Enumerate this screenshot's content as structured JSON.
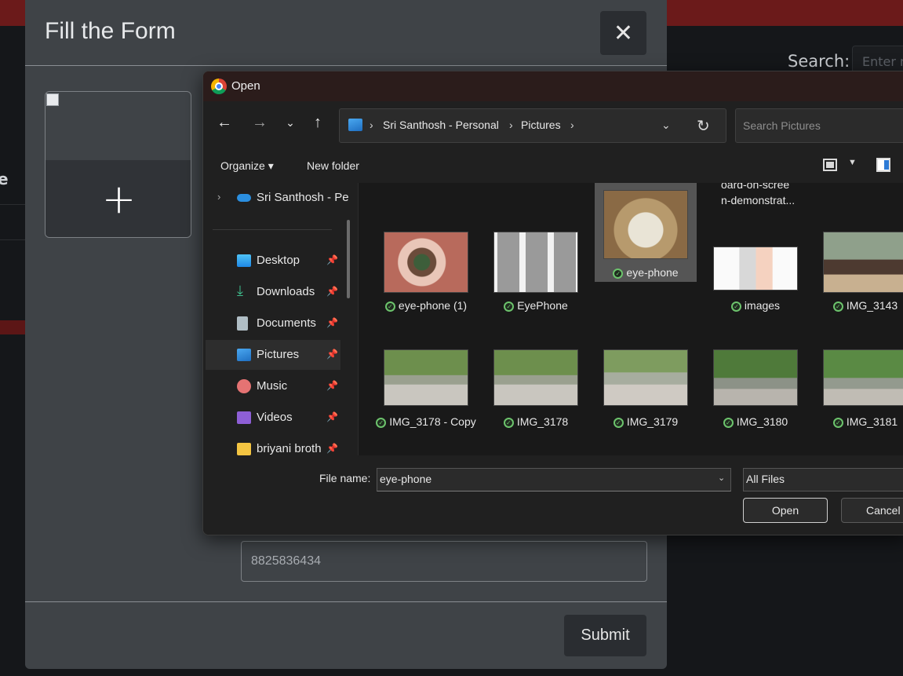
{
  "background_page": {
    "edge_char": "e",
    "search_label": "Search:",
    "search_placeholder": "Enter n"
  },
  "modal": {
    "title": "Fill the Form",
    "close_glyph": "✕",
    "add_image_glyph": "+",
    "phone_value": "8825836434",
    "submit_label": "Submit"
  },
  "dialog": {
    "title": "Open",
    "breadcrumb": [
      "Sri Santhosh - Personal",
      "Pictures"
    ],
    "search_placeholder": "Search Pictures",
    "toolbar": {
      "organize": "Organize ▾",
      "new_folder": "New folder"
    },
    "nav_items": [
      {
        "label": "Sri Santhosh - Pe",
        "icon": "onedrive-icon"
      },
      {
        "label": "Desktop",
        "icon": "desktop-icon",
        "pinned": true
      },
      {
        "label": "Downloads",
        "icon": "download-icon",
        "pinned": true
      },
      {
        "label": "Documents",
        "icon": "documents-icon",
        "pinned": true
      },
      {
        "label": "Pictures",
        "icon": "pictures-icon",
        "pinned": true,
        "selected": true
      },
      {
        "label": "Music",
        "icon": "music-icon",
        "pinned": true
      },
      {
        "label": "Videos",
        "icon": "videos-icon",
        "pinned": true
      },
      {
        "label": "briyani broth",
        "icon": "folder-icon",
        "pinned": true
      }
    ],
    "partial_file_name": "oard-on-scree\nn-demonstrat...",
    "files": [
      {
        "name": "eye-phone (1)",
        "thumb": "eye-closeup"
      },
      {
        "name": "EyePhone",
        "thumb": "grid-portraits"
      },
      {
        "name": "eye-phone",
        "thumb": "eye-phone-poster",
        "selected": true
      },
      {
        "name": "images",
        "thumb": "hands-reaching"
      },
      {
        "name": "IMG_3143",
        "thumb": "interior"
      },
      {
        "name": "IMG_3178 - Copy",
        "thumb": "road-person"
      },
      {
        "name": "IMG_3178",
        "thumb": "road-person"
      },
      {
        "name": "IMG_3179",
        "thumb": "road-person"
      },
      {
        "name": "IMG_3180",
        "thumb": "road-person-close"
      },
      {
        "name": "IMG_3181",
        "thumb": "road-person-close"
      }
    ],
    "file_name_label": "File name:",
    "file_name_value": "eye-phone",
    "file_type_value": "All Files",
    "open_label": "Open",
    "cancel_label": "Cancel"
  }
}
